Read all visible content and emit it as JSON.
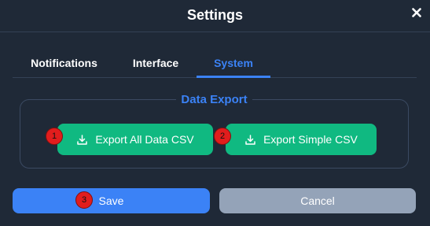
{
  "dialog": {
    "title": "Settings",
    "close_icon": "close-icon"
  },
  "tabs": [
    {
      "label": "Notifications",
      "active": false
    },
    {
      "label": "Interface",
      "active": false
    },
    {
      "label": "System",
      "active": true
    }
  ],
  "data_export": {
    "legend": "Data Export",
    "buttons": [
      {
        "label": "Export All Data CSV",
        "icon": "download-icon"
      },
      {
        "label": "Export Simple CSV",
        "icon": "download-icon"
      }
    ]
  },
  "footer": {
    "save_label": "Save",
    "cancel_label": "Cancel"
  },
  "markers": [
    "1",
    "2",
    "3"
  ],
  "colors": {
    "background": "#1f2937",
    "accent": "#3b82f6",
    "export_button": "#10b981",
    "cancel_button": "#94a3b8",
    "marker": "#e11d1d"
  }
}
